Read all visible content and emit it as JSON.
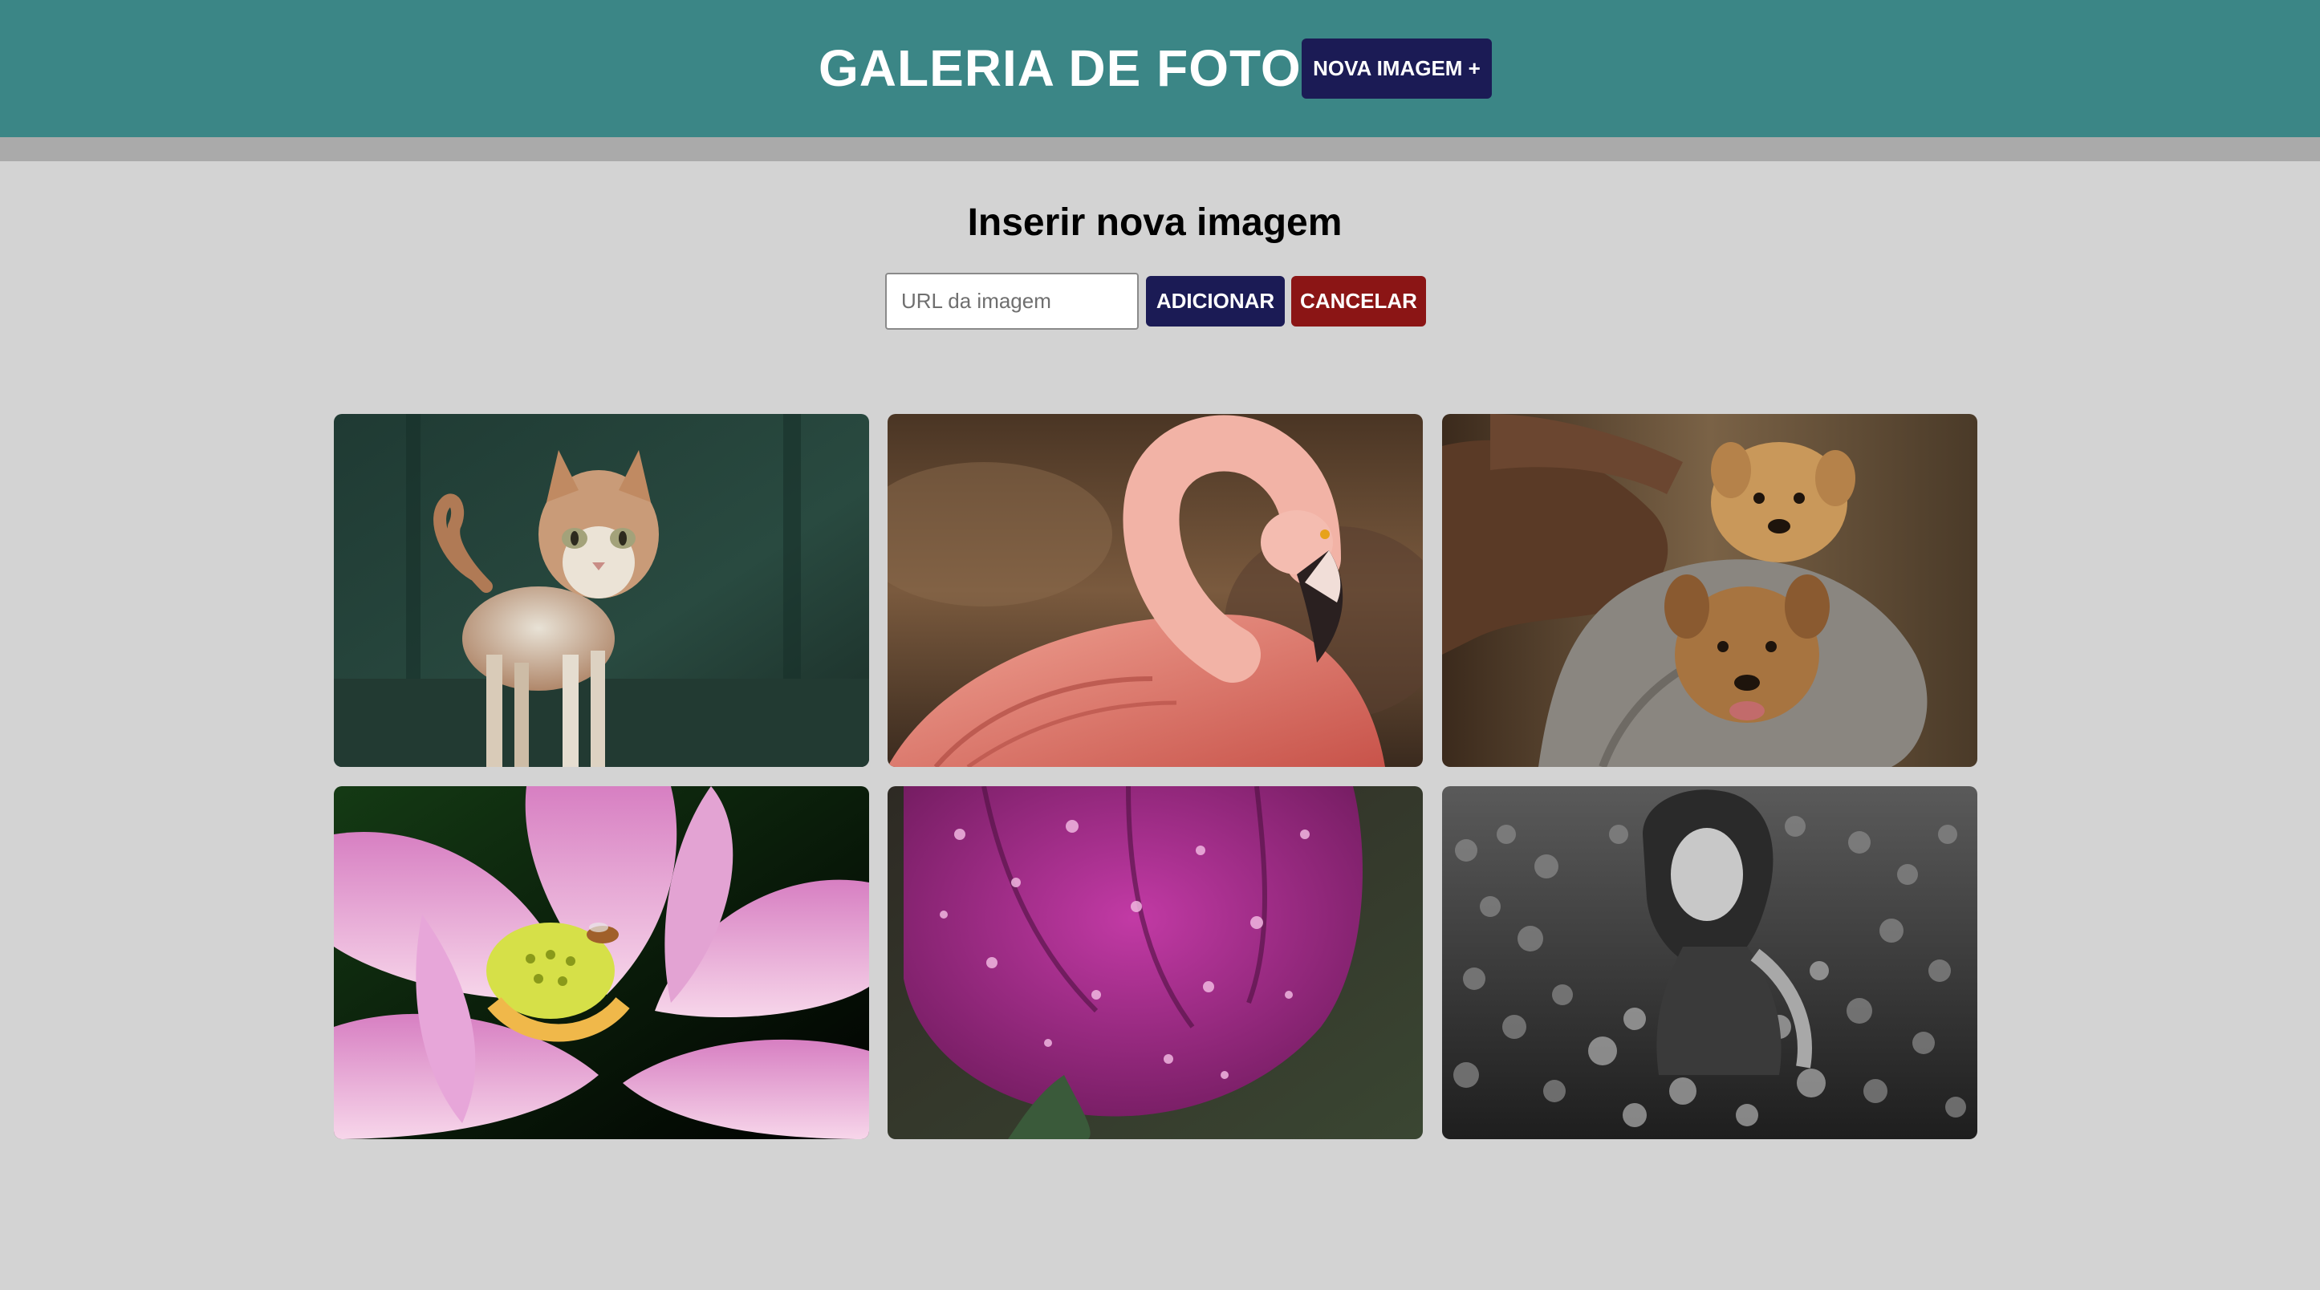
{
  "header": {
    "title": "GALERIA DE FOTOS",
    "new_image_label": "NOVA IMAGEM +"
  },
  "form": {
    "heading": "Inserir nova imagem",
    "url_placeholder": "URL da imagem",
    "url_value": "",
    "add_label": "ADICIONAR",
    "cancel_label": "CANCELAR"
  },
  "gallery": {
    "photos": [
      {
        "subject": "cat"
      },
      {
        "subject": "flamingo"
      },
      {
        "subject": "puppies"
      },
      {
        "subject": "lotus-flower-with-bee"
      },
      {
        "subject": "purple-flower-with-raindrops"
      },
      {
        "subject": "woman-in-flower-field"
      }
    ]
  },
  "colors": {
    "header_bg": "#3b8686",
    "header_strip": "#aaaaaa",
    "page_bg": "#d3d3d3",
    "primary_button": "#1b1b55",
    "cancel_button": "#8b1515"
  }
}
